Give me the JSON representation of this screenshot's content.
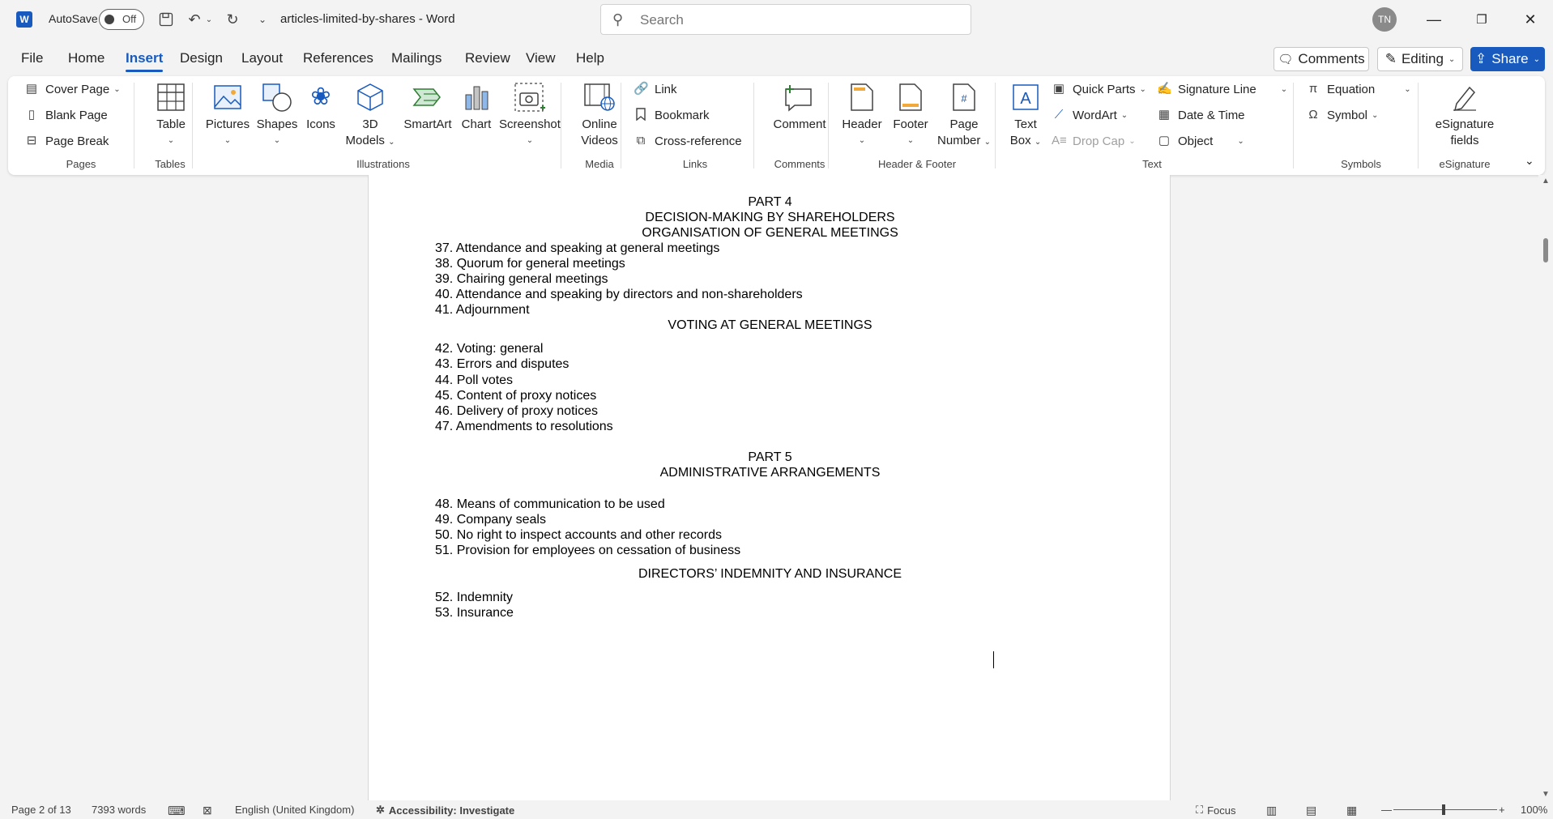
{
  "titlebar": {
    "app_logo": "W",
    "autosave_label": "AutoSave",
    "autosave_state": "Off",
    "doc_title": "articles-limited-by-shares  -  Word",
    "search_placeholder": "Search",
    "user_initials": "TN"
  },
  "menu": {
    "tabs": [
      "File",
      "Home",
      "Insert",
      "Design",
      "Layout",
      "References",
      "Mailings",
      "Review",
      "View",
      "Help"
    ],
    "active_tab": "Insert",
    "comments_label": "Comments",
    "editing_label": "Editing",
    "share_label": "Share"
  },
  "ribbon": {
    "pages": {
      "cover_page": "Cover Page",
      "blank_page": "Blank Page",
      "page_break": "Page Break",
      "label": "Pages"
    },
    "tables": {
      "table": "Table",
      "label": "Tables"
    },
    "illustrations": {
      "pictures": "Pictures",
      "shapes": "Shapes",
      "icons": "Icons",
      "models_line1": "3D",
      "models_line2": "Models",
      "smartart": "SmartArt",
      "chart": "Chart",
      "screenshot": "Screenshot",
      "label": "Illustrations"
    },
    "media": {
      "online_line1": "Online",
      "online_line2": "Videos",
      "label": "Media"
    },
    "links": {
      "link": "Link",
      "bookmark": "Bookmark",
      "cross_reference": "Cross-reference",
      "label": "Links"
    },
    "comments": {
      "comment": "Comment",
      "label": "Comments"
    },
    "header_footer": {
      "header": "Header",
      "footer": "Footer",
      "page_number_line1": "Page",
      "page_number_line2": "Number",
      "label": "Header & Footer"
    },
    "text": {
      "textbox_line1": "Text",
      "textbox_line2": "Box",
      "quick_parts": "Quick Parts",
      "wordart": "WordArt",
      "drop_cap": "Drop Cap",
      "signature_line": "Signature Line",
      "date_time": "Date & Time",
      "object": "Object",
      "label": "Text"
    },
    "symbols": {
      "equation": "Equation",
      "symbol": "Symbol",
      "label": "Symbols"
    },
    "esignature": {
      "line1": "eSignature",
      "line2": "fields",
      "label": "eSignature"
    }
  },
  "document": {
    "part4_title": "PART 4",
    "part4_subtitle": "DECISION-MAKING BY SHAREHOLDERS",
    "org_heading": "ORGANISATION OF GENERAL MEETINGS",
    "org_items": [
      "37. Attendance and speaking at general meetings",
      "38. Quorum for general meetings",
      "39. Chairing general meetings",
      "40. Attendance and speaking by directors and non-shareholders",
      "41. Adjournment"
    ],
    "voting_heading": "VOTING AT GENERAL MEETINGS",
    "voting_items": [
      "42. Voting: general",
      "43. Errors and disputes",
      "44. Poll votes",
      "45. Content of proxy notices",
      "46. Delivery of proxy notices",
      "47. Amendments to resolutions"
    ],
    "part5_title": "PART 5",
    "part5_subtitle": "ADMINISTRATIVE ARRANGEMENTS",
    "admin_items": [
      "48. Means of communication to be used",
      "49. Company seals",
      "50. No right to inspect accounts and other records",
      "51. Provision for employees on cessation of business"
    ],
    "indemnity_heading": "DIRECTORS’ INDEMNITY AND INSURANCE",
    "indemnity_items": [
      "52. Indemnity",
      "53. Insurance"
    ]
  },
  "status": {
    "page": "Page 2 of 13",
    "words": "7393 words",
    "language": "English (United Kingdom)",
    "accessibility": "Accessibility: Investigate",
    "focus": "Focus",
    "zoom": "100%"
  },
  "colors": {
    "accent": "#185abd",
    "background": "#f3f3f3"
  }
}
